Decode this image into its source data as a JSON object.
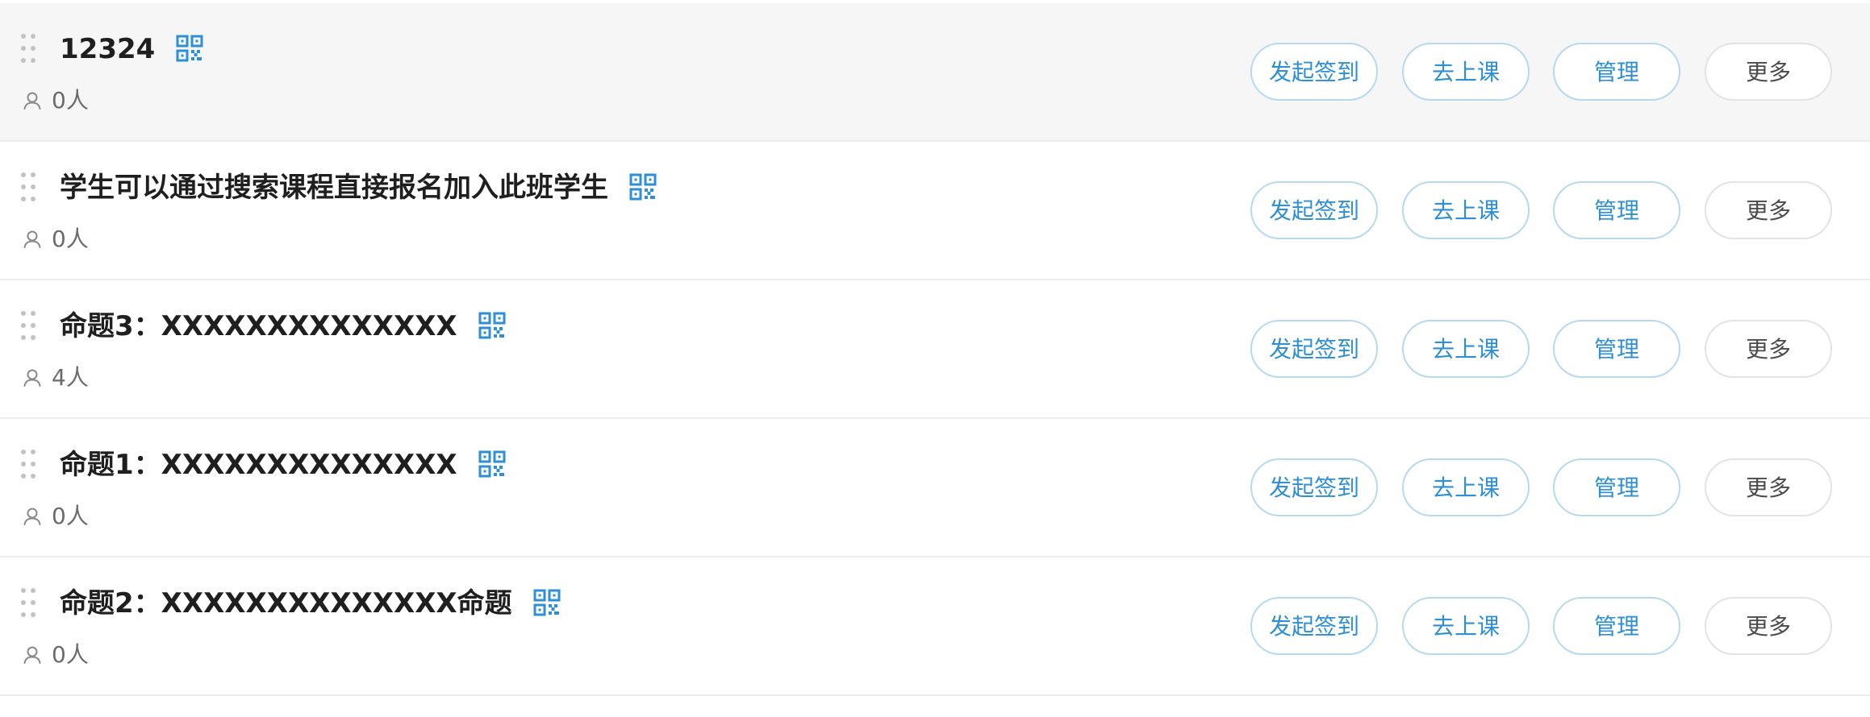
{
  "colors": {
    "accent": "#2d8fd5",
    "accent_border": "#b6d9f2",
    "hover_row_bg": "#f6f6f6",
    "divider": "#ededed",
    "title_text": "#1f1f1f",
    "muted_text": "#6b6b6b"
  },
  "icons": {
    "drag": "drag-handle-icon",
    "qr": "qr-code-icon",
    "person": "person-icon"
  },
  "actions": {
    "sign_in": "发起签到",
    "attend_class": "去上课",
    "manage": "管理",
    "more": "更多"
  },
  "classes": [
    {
      "title": "12324",
      "count": "0人",
      "hovered": true
    },
    {
      "title": "学生可以通过搜索课程直接报名加入此班学生",
      "count": "0人",
      "hovered": false
    },
    {
      "title": "命题3：XXXXXXXXXXXXXX",
      "count": "4人",
      "hovered": false
    },
    {
      "title": "命题1：XXXXXXXXXXXXXX",
      "count": "0人",
      "hovered": false
    },
    {
      "title": "命题2：XXXXXXXXXXXXXX命题",
      "count": "0人",
      "hovered": false
    }
  ]
}
